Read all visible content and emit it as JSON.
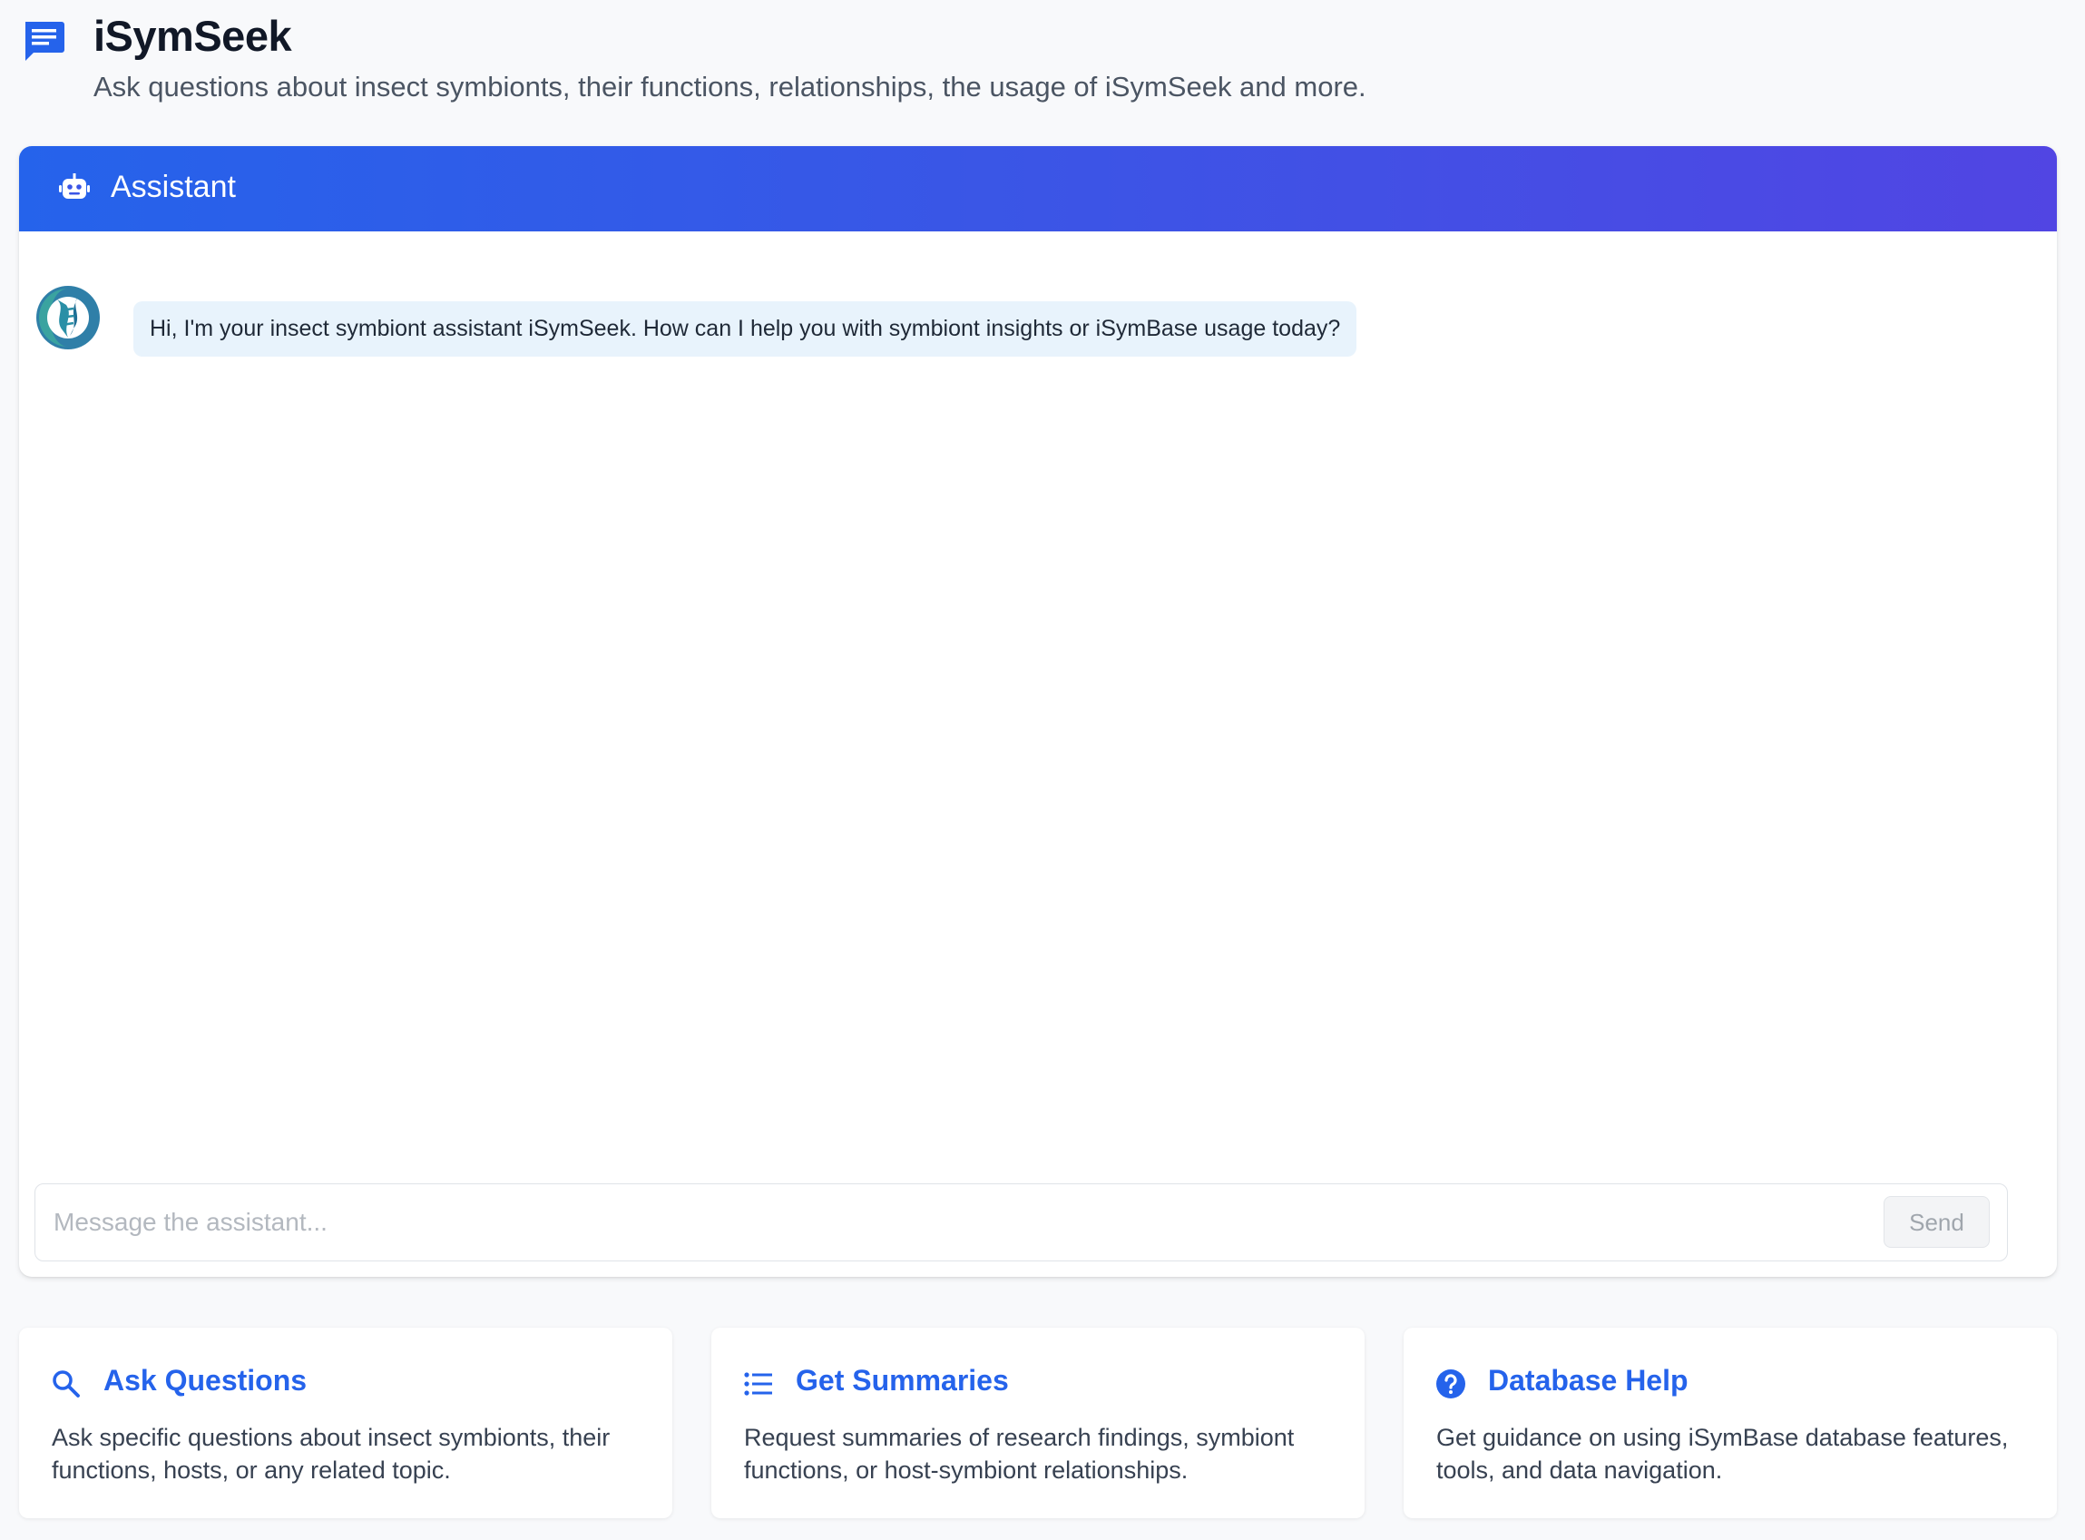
{
  "app": {
    "title": "iSymSeek",
    "subtitle": "Ask questions about insect symbionts, their functions, relationships, the usage of iSymSeek and more.",
    "icon": "chat-message-icon",
    "accent_color": "#2563eb"
  },
  "chat": {
    "header_label": "Assistant",
    "header_icon": "robot-icon",
    "messages": [
      {
        "role": "assistant",
        "avatar": "symbiont-logo-avatar",
        "text": "Hi, I'm your insect symbiont assistant iSymSeek. How can I help you with symbiont insights or iSymBase usage today?"
      }
    ],
    "input": {
      "placeholder": "Message the assistant...",
      "value": ""
    },
    "send_label": "Send"
  },
  "features": [
    {
      "icon": "search-icon",
      "title": "Ask Questions",
      "description": "Ask specific questions about insect symbionts, their functions, hosts, or any related topic."
    },
    {
      "icon": "list-icon",
      "title": "Get Summaries",
      "description": "Request summaries of research findings, symbiont functions, or host-symbiont relationships."
    },
    {
      "icon": "help-circle-icon",
      "title": "Database Help",
      "description": "Get guidance on using iSymBase database features, tools, and data navigation."
    }
  ]
}
